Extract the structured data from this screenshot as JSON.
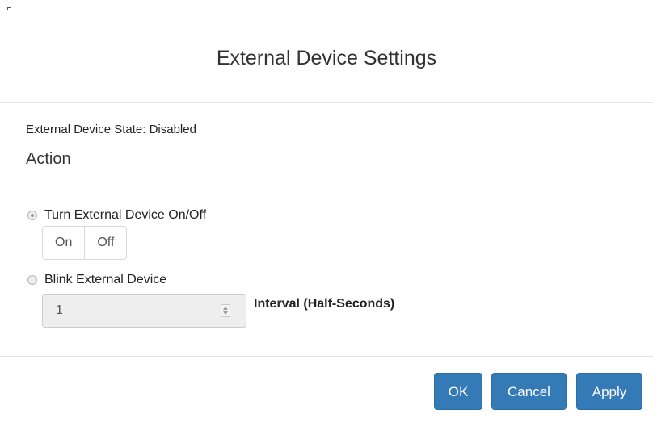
{
  "dialog": {
    "title": "External Device Settings"
  },
  "status": {
    "state_text": "External Device State: Disabled"
  },
  "action": {
    "heading": "Action",
    "options": [
      {
        "label": "Turn External Device On/Off",
        "selected": true
      },
      {
        "label": "Blink External Device",
        "selected": false
      }
    ],
    "toggle_buttons": [
      "On",
      "Off"
    ],
    "interval": {
      "value": "1",
      "label": "Interval (Half-Seconds)"
    }
  },
  "footer": {
    "ok_label": "OK",
    "cancel_label": "Cancel",
    "apply_label": "Apply"
  },
  "colors": {
    "primary": "#337ab7",
    "primary_border": "#2e6da4",
    "disabled_input_bg": "#eeeeee",
    "divider": "#e5e5e5"
  },
  "icons": {
    "spinner": "number-spinner-icon",
    "radio": "radio-button-icon"
  }
}
